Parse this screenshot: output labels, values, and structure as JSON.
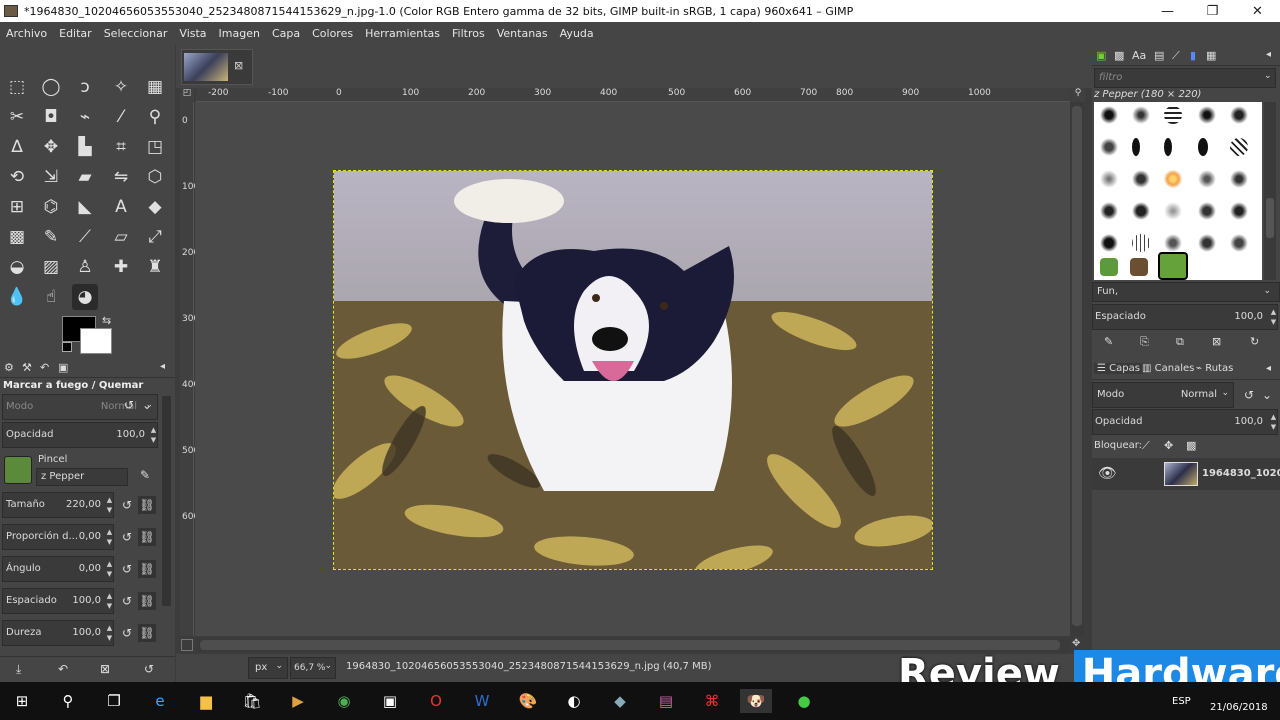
{
  "window": {
    "title": "*1964830_10204656053553040_2523480871544153629_n.jpg-1.0 (Color RGB Entero gamma de 32 bits, GIMP built-in sRGB, 1 capa) 960x641 – GIMP",
    "minimize": "—",
    "maximize": "❐",
    "close": "✕"
  },
  "menu": [
    "Archivo",
    "Editar",
    "Seleccionar",
    "Vista",
    "Imagen",
    "Capa",
    "Colores",
    "Herramientas",
    "Filtros",
    "Ventanas",
    "Ayuda"
  ],
  "tool_options": {
    "title": "Marcar a fuego / Quemar",
    "mode_label": "Modo",
    "mode_value": "Normal",
    "opacity_label": "Opacidad",
    "opacity_value": "100,0",
    "brush_label": "Pincel",
    "brush_value": "z Pepper",
    "size_label": "Tamaño",
    "size_value": "220,00",
    "ratio_label": "Proporción d...",
    "ratio_value": "0,00",
    "angle_label": "Ángulo",
    "angle_value": "0,00",
    "spacing_label": "Espaciado",
    "spacing_value": "100,0",
    "hardness_label": "Dureza",
    "hardness_value": "100,0"
  },
  "rulers": {
    "h_ticks": [
      "-200",
      "-100",
      "0",
      "100",
      "200",
      "300",
      "400",
      "500",
      "600",
      "700",
      "800",
      "900",
      "1000"
    ],
    "v_ticks": [
      "0",
      "100",
      "200",
      "300",
      "400",
      "500",
      "600"
    ]
  },
  "status": {
    "unit": "px",
    "zoom": "66,7 %",
    "filename": "1964830_10204656053553040_2523480871544153629_n.jpg (40,7 MB)"
  },
  "brushes": {
    "filter_placeholder": "filtro",
    "selected": "z Pepper (180 × 220)",
    "tag": "Fun,",
    "spacing_label": "Espaciado",
    "spacing_value": "100,0"
  },
  "layers": {
    "tabs": [
      "Capas",
      "Canales",
      "Rutas"
    ],
    "mode_label": "Modo",
    "mode_value": "Normal",
    "opacity_label": "Opacidad",
    "opacity_value": "100,0",
    "lock_label": "Bloquear:",
    "layer_name": "1964830_1020"
  },
  "taskbar": {
    "lang": "ESP",
    "date": "21/06/2018"
  },
  "watermark": {
    "word1": "Review",
    "word2": "Hardware"
  },
  "colors": {
    "accent_blue": "#1e7fd6",
    "bg_dark": "#454545",
    "watermark_blue": "#1e88e5"
  }
}
